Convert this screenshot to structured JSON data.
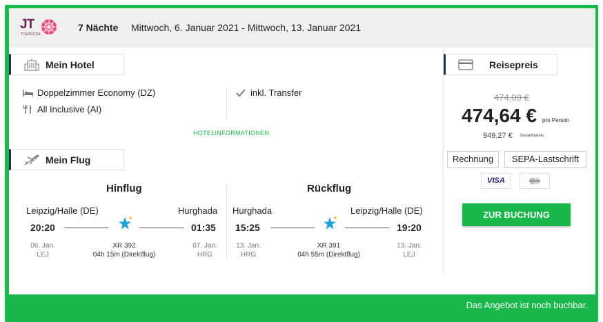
{
  "header": {
    "logo_text": "JT",
    "logo_sub": "TOURISTIK",
    "nights": "7 Nächte",
    "dates": "Mittwoch, 6. Januar 2021 - Mittwoch, 13. Januar 2021"
  },
  "hotel": {
    "section_title": "Mein Hotel",
    "room": "Doppelzimmer Economy (DZ)",
    "board": "All Inclusive (AI)",
    "transfer": "inkl. Transfer",
    "info_link": "HOTELINFORMATIONEN"
  },
  "flight": {
    "section_title": "Mein Flug",
    "outbound": {
      "title": "Hinflug",
      "from_city": "Leipzig/Halle (DE)",
      "to_city": "Hurghada",
      "dep_time": "20:20",
      "arr_time": "01:35",
      "dep_date": "06. Jan.",
      "dep_code": "LEJ",
      "arr_date": "07. Jan.",
      "arr_code": "HRG",
      "flight_no": "XR 392",
      "duration": "04h 15m (Direktflug)"
    },
    "return": {
      "title": "Rückflug",
      "from_city": "Hurghada",
      "to_city": "Leipzig/Halle (DE)",
      "dep_time": "15:25",
      "arr_time": "19:20",
      "dep_date": "13. Jan.",
      "dep_code": "HRG",
      "arr_date": "13. Jan.",
      "arr_code": "LEJ",
      "flight_no": "XR 391",
      "duration": "04h 55m (Direktflug)"
    }
  },
  "price": {
    "section_title": "Reisepreis",
    "old_price": "474,00 €",
    "price": "474,64 €",
    "per_person": "pro Person",
    "total": "949,27 €",
    "total_label": "Gesamtpreis",
    "payment_options": [
      "Rechnung",
      "SEPA-Lastschrift"
    ],
    "cards": [
      "VISA",
      "mastercard"
    ],
    "book_button": "ZUR BUCHUNG"
  },
  "footer": {
    "status": "Das Angebot ist noch buchbar."
  },
  "colors": {
    "accent": "#19b84a",
    "brand": "#6b1e54",
    "logo_pink": "#e8457a",
    "tab_border": "#1e3048"
  },
  "icons": {
    "hotel": "hotel-building-icon",
    "room": "bed-icon",
    "board": "cutlery-icon",
    "transfer": "check-icon",
    "flight": "airplane-icon",
    "airline": "airline-star-icon",
    "price": "credit-card-icon"
  }
}
